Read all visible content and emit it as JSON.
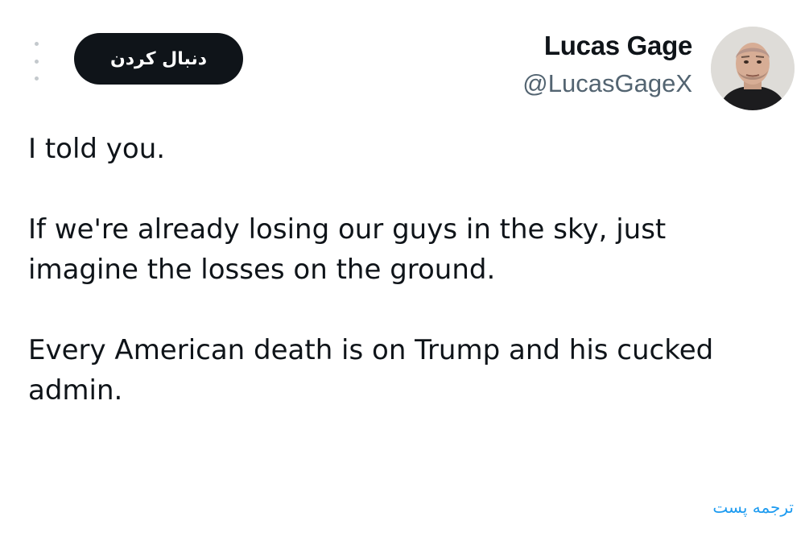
{
  "author": {
    "name": "Lucas Gage",
    "handle": "@LucasGageX",
    "avatar_icon": "user-avatar-photo"
  },
  "actions": {
    "follow_label": "دنبال کردن",
    "more_icon": "more-vertical-icon",
    "translate_label": "ترجمه پست"
  },
  "post": {
    "paragraphs": [
      "I told you.",
      "If we're already losing our guys in the sky, just imagine the losses on the ground.",
      "Every American death is on Trump and his cucked admin."
    ]
  },
  "colors": {
    "text": "#0f1419",
    "secondary": "#536471",
    "accent": "#1d9bf0",
    "button_bg": "#0f1419"
  }
}
